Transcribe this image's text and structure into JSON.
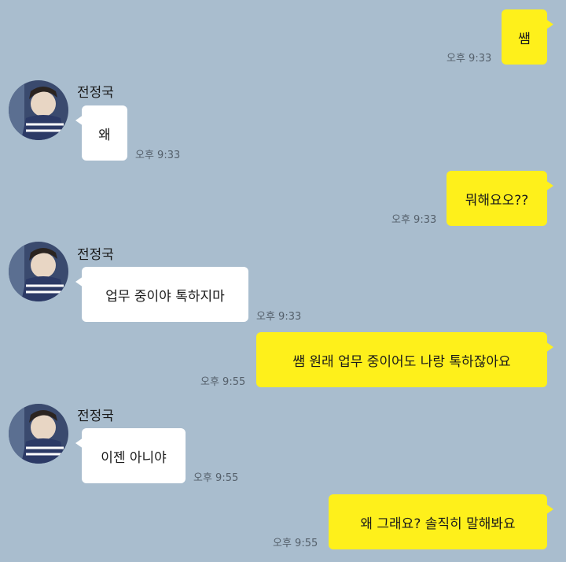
{
  "contact": {
    "name": "전정국"
  },
  "messages": [
    {
      "sender": "me",
      "text": "쌤",
      "time": "오후 9:33"
    },
    {
      "sender": "them",
      "text": "왜",
      "time": "오후 9:33"
    },
    {
      "sender": "me",
      "text": "뭐해요오??",
      "time": "오후 9:33"
    },
    {
      "sender": "them",
      "text": "업무 중이야 톡하지마",
      "time": "오후 9:33"
    },
    {
      "sender": "me",
      "text": "쌤 원래 업무 중이어도 나랑 톡하잖아요",
      "time": "오후 9:55"
    },
    {
      "sender": "them",
      "text": "이젠 아니야",
      "time": "오후 9:55"
    },
    {
      "sender": "me",
      "text": "왜 그래요? 솔직히 말해봐요",
      "time": "오후 9:55"
    }
  ],
  "colors": {
    "background": "#a9bdce",
    "my_bubble": "#fef01b",
    "their_bubble": "#ffffff"
  },
  "icons": {
    "avatar": "avatar-icon"
  }
}
